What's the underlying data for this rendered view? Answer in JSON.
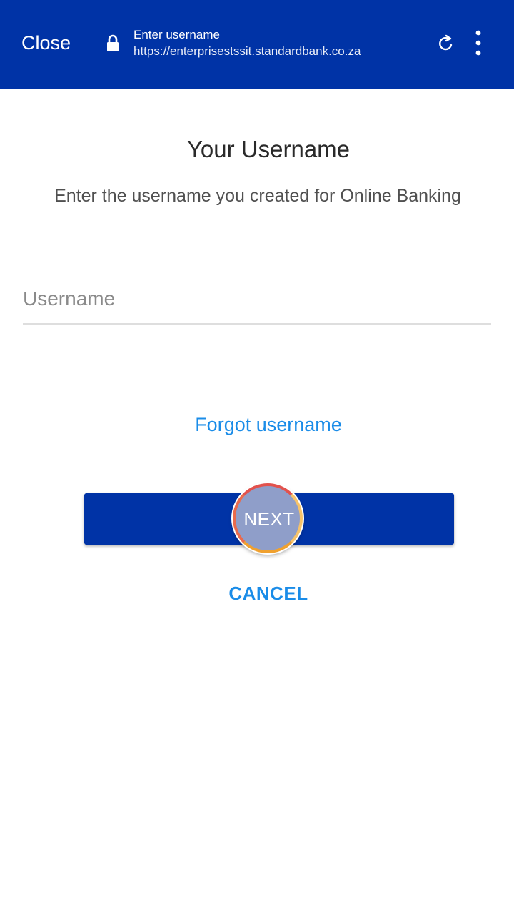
{
  "browser_bar": {
    "close_label": "Close",
    "page_title": "Enter username",
    "url": "https://enterprisestssit.standardbank.co.za",
    "icons": [
      "lock-icon",
      "refresh-icon",
      "more-vert-icon"
    ],
    "color": "#0033a6"
  },
  "main": {
    "title": "Your Username",
    "subtitle": "Enter the username you created for Online Banking",
    "username_field": {
      "placeholder": "Username",
      "value": ""
    },
    "forgot_link": "Forgot username",
    "next_label": "NEXT",
    "cancel_label": "CANCEL"
  },
  "colors": {
    "primary": "#0033a6",
    "link": "#1a8ce8",
    "text": "#2a2a2a"
  }
}
